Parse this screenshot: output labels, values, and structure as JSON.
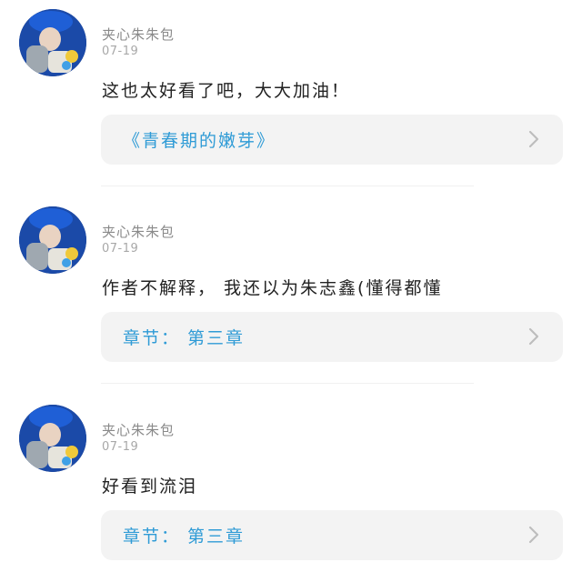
{
  "comments": [
    {
      "username": "夹心朱朱包",
      "date": "07-19",
      "content": "这也太好看了吧，大大加油！",
      "reference": "《青春期的嫩芽》"
    },
    {
      "username": "夹心朱朱包",
      "date": "07-19",
      "content": "作者不解释， 我还以为朱志鑫(懂得都懂",
      "reference": "章节： 第三章"
    },
    {
      "username": "夹心朱朱包",
      "date": "07-19",
      "content": "好看到流泪",
      "reference": "章节： 第三章"
    }
  ],
  "colors": {
    "link": "#2f9bd6",
    "card_background": "#f3f3f3",
    "username": "#8a8a8a",
    "date": "#a8a8a8"
  },
  "icons": {
    "chevron": "chevron-right-icon",
    "avatar": "user-avatar"
  }
}
